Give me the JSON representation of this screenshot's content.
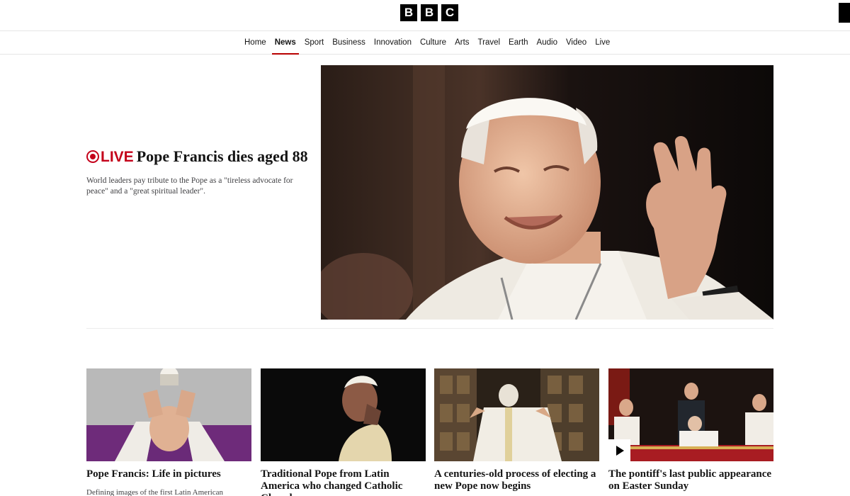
{
  "header": {
    "logo_letters": [
      "B",
      "B",
      "C"
    ]
  },
  "nav": {
    "items": [
      {
        "label": "Home",
        "active": false
      },
      {
        "label": "News",
        "active": true
      },
      {
        "label": "Sport",
        "active": false
      },
      {
        "label": "Business",
        "active": false
      },
      {
        "label": "Innovation",
        "active": false
      },
      {
        "label": "Culture",
        "active": false
      },
      {
        "label": "Arts",
        "active": false
      },
      {
        "label": "Travel",
        "active": false
      },
      {
        "label": "Earth",
        "active": false
      },
      {
        "label": "Audio",
        "active": false
      },
      {
        "label": "Video",
        "active": false
      },
      {
        "label": "Live",
        "active": false
      }
    ]
  },
  "hero": {
    "live_label": "LIVE",
    "title": "Pope Francis dies aged 88",
    "summary": "World leaders pay tribute to the Pope as a \"tireless advocate for peace\" and a \"great spiritual leader\"."
  },
  "cards": [
    {
      "title": "Pope Francis: Life in pictures",
      "summary": "Defining images of the first Latin American"
    },
    {
      "title": "Traditional Pope from Latin America who changed Catholic Church",
      "summary": ""
    },
    {
      "title": "A centuries-old process of electing a new Pope now begins",
      "summary": ""
    },
    {
      "title": "The pontiff's last public appearance on Easter Sunday",
      "summary": ""
    }
  ],
  "colors": {
    "accent_red": "#b80000",
    "live_red": "#c4001a"
  }
}
